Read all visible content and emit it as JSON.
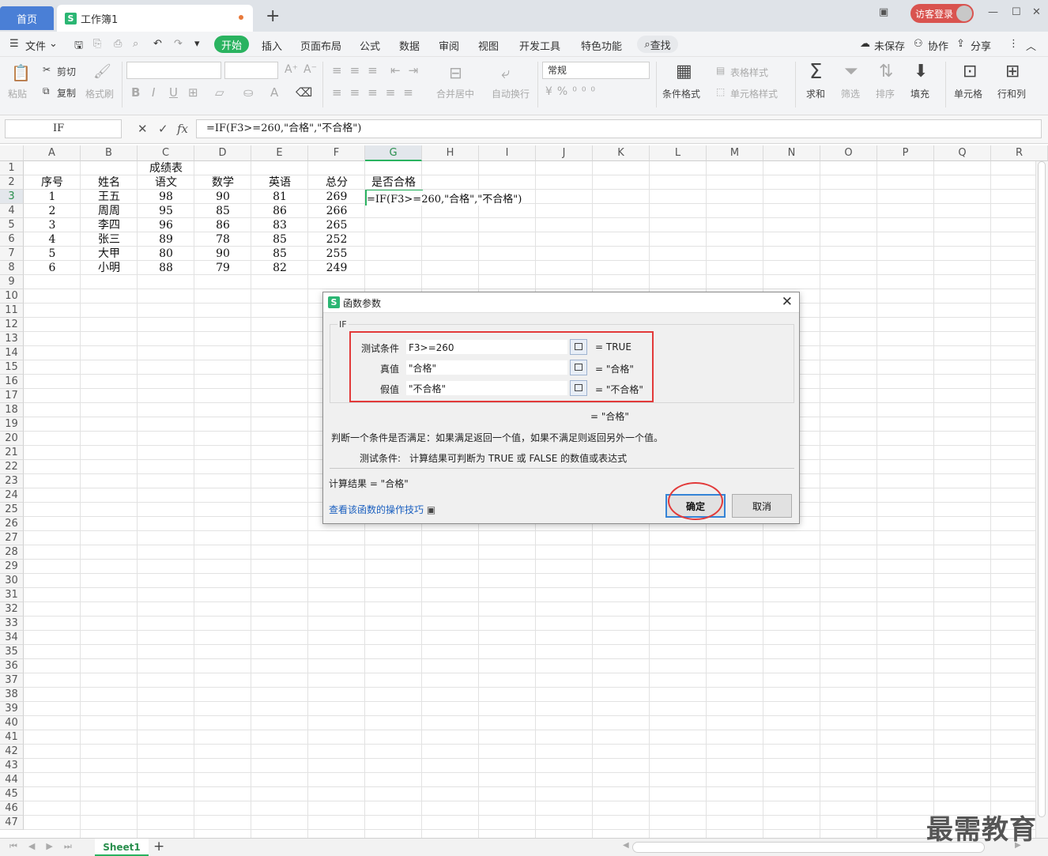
{
  "titlebar": {
    "home_tab": "首页",
    "doc_tab": "工作簿1",
    "logo": "S",
    "new_tab": "+",
    "guest_login": "访客登录"
  },
  "menubar": {
    "file": "文件",
    "items": [
      "开始",
      "插入",
      "页面布局",
      "公式",
      "数据",
      "审阅",
      "视图",
      "开发工具",
      "特色功能"
    ],
    "search": "查找",
    "unsaved": "未保存",
    "collab": "协作",
    "share": "分享"
  },
  "ribbon": {
    "paste": "粘贴",
    "cut": "剪切",
    "copy": "复制",
    "format_painter": "格式刷",
    "merge": "合并居中",
    "wrap": "自动换行",
    "number_format": "常规",
    "cond_format": "条件格式",
    "table_style": "表格样式",
    "cell_style": "单元格样式",
    "sum": "求和",
    "filter": "筛选",
    "sort": "排序",
    "fill": "填充",
    "cell": "单元格",
    "row_col": "行和列"
  },
  "formula_bar": {
    "name_box": "IF",
    "formula": "=IF(F3>=260,\"合格\",\"不合格\")"
  },
  "grid": {
    "columns": [
      "A",
      "B",
      "C",
      "D",
      "E",
      "F",
      "G",
      "H",
      "I",
      "J",
      "K",
      "L",
      "M",
      "N",
      "O",
      "P",
      "Q",
      "R"
    ],
    "rows": [
      "1",
      "2",
      "3",
      "4",
      "5",
      "6",
      "7",
      "8",
      "9",
      "10",
      "11",
      "12",
      "13",
      "14",
      "15",
      "16",
      "17",
      "18",
      "19",
      "20",
      "21",
      "22",
      "23",
      "24",
      "25",
      "26",
      "27",
      "28",
      "29",
      "30",
      "31",
      "32",
      "33",
      "34",
      "35",
      "36",
      "37",
      "38",
      "39",
      "40",
      "41",
      "42",
      "43",
      "44",
      "45",
      "46",
      "47"
    ],
    "title": "成绩表",
    "headers": [
      "序号",
      "姓名",
      "语文",
      "数学",
      "英语",
      "总分",
      "是否合格"
    ],
    "data": [
      [
        "1",
        "王五",
        "98",
        "90",
        "81",
        "269"
      ],
      [
        "2",
        "周周",
        "95",
        "85",
        "86",
        "266"
      ],
      [
        "3",
        "李四",
        "96",
        "86",
        "83",
        "265"
      ],
      [
        "4",
        "张三",
        "89",
        "78",
        "85",
        "252"
      ],
      [
        "5",
        "大甲",
        "80",
        "90",
        "85",
        "255"
      ],
      [
        "6",
        "小明",
        "88",
        "79",
        "82",
        "249"
      ]
    ],
    "editing": "=IF(F3>=260,\"合格\",\"不合格\")"
  },
  "sheet": {
    "tab": "Sheet1",
    "add": "+"
  },
  "dialog": {
    "title": "函数参数",
    "func": "IF",
    "params": [
      {
        "label": "测试条件",
        "value": "F3>=260",
        "result": "TRUE"
      },
      {
        "label": "真值",
        "value": "\"合格\"",
        "result": "\"合格\""
      },
      {
        "label": "假值",
        "value": "\"不合格\"",
        "result": "\"不合格\""
      }
    ],
    "overall": "=  \"合格\"",
    "description": "判断一个条件是否满足：如果满足返回一个值，如果不满足则返回另外一个值。",
    "param_desc_label": "测试条件:",
    "param_desc": "计算结果可判断为 TRUE 或 FALSE 的数值或表达式",
    "calc_label": "计算结果  =  \"合格\"",
    "help_link": "查看该函数的操作技巧",
    "ok": "确定",
    "cancel": "取消"
  },
  "watermark": "最需教育",
  "colors": {
    "accent": "#2ab360",
    "highlight": "#e23a3a",
    "link": "#1a5fbf"
  }
}
